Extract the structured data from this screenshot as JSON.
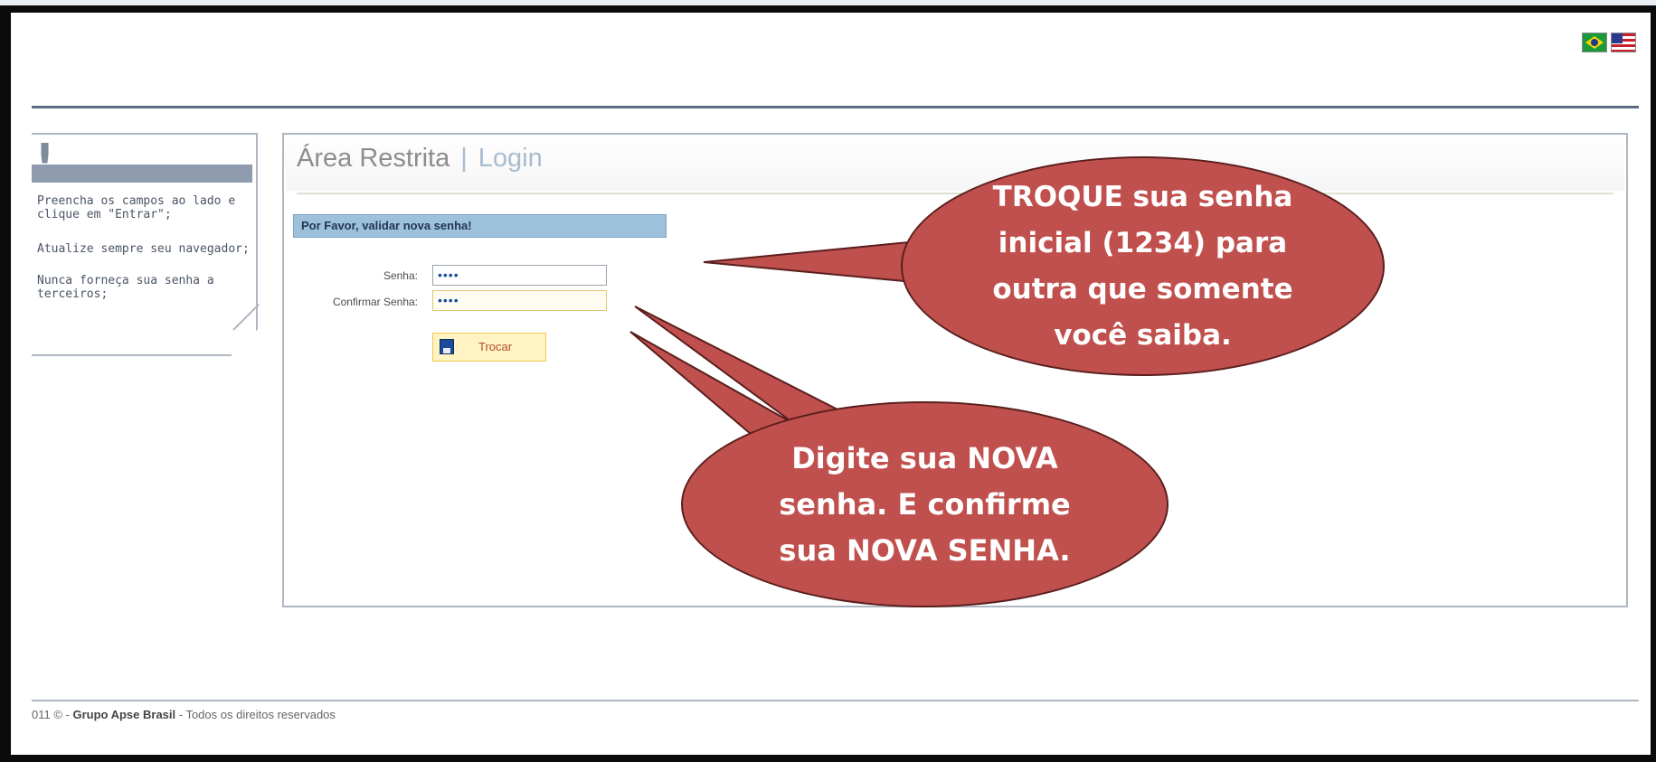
{
  "flags": [
    {
      "name": "brazil-flag-icon"
    },
    {
      "name": "usa-flag-icon"
    }
  ],
  "sidebar": {
    "instructions": [
      "Preencha os campos ao lado e clique em \"Entrar\";",
      "Atualize sempre seu navegador;",
      "Nunca forneça sua senha a terceiros;"
    ]
  },
  "panel": {
    "title": "Área Restrita",
    "separator": "|",
    "subtitle": "Login",
    "notice": "Por Favor, validar nova senha!",
    "fields": {
      "password_label": "Senha:",
      "password_value": "••••",
      "confirm_label": "Confirmar Senha:",
      "confirm_value": "••••"
    },
    "button_label": "Trocar"
  },
  "callouts": {
    "top": [
      "TROQUE sua senha",
      "inicial (1234) para",
      "outra que somente",
      "você saiba."
    ],
    "bottom": [
      "Digite sua NOVA",
      "senha. E confirme",
      "sua NOVA SENHA."
    ],
    "color": "#c0504d"
  },
  "footer": {
    "year_prefix": "011 © - ",
    "company": "Grupo Apse Brasil",
    "rights": " - Todos os direitos reservados"
  }
}
